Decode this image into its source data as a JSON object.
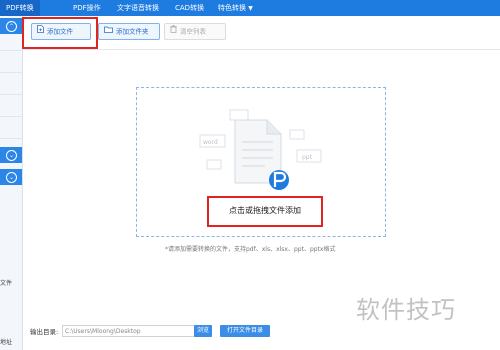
{
  "tabs": [
    {
      "label": "PDF转换",
      "active": true
    },
    {
      "label": "PDF操作",
      "active": false
    },
    {
      "label": "文字语音转换",
      "active": false
    },
    {
      "label": "CAD转换",
      "active": false
    },
    {
      "label": "特色转换",
      "active": false
    }
  ],
  "toolbar": {
    "add_file": "添加文件",
    "add_folder": "添加文件夹",
    "clear_list": "清空列表"
  },
  "dropzone": {
    "label": "点击或拖拽文件添加",
    "hint": "*请添加需要转换的文件，支持pdf、xls、xlsx、ppt、pptx格式",
    "icon_labels": {
      "word": "word",
      "ppt": "ppt"
    }
  },
  "sidebar": {
    "text_1": "文件",
    "text_2": "地址"
  },
  "output": {
    "label": "输出目录:",
    "path": "C:\\Users\\Mloong\\Desktop",
    "browse": "浏览",
    "open_dir": "打开文件目录"
  },
  "watermark": "软件技巧",
  "colors": {
    "topbar": "#1e7be0",
    "accent": "#3b8de6",
    "highlight_box": "#e02424"
  }
}
